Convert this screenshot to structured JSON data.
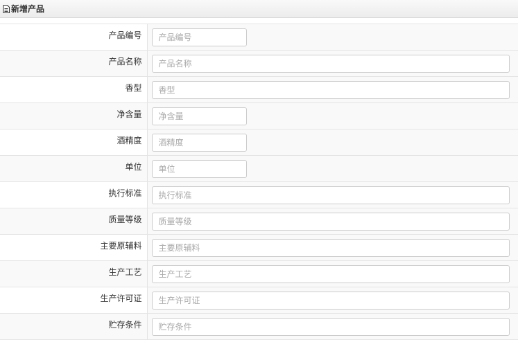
{
  "header": {
    "title": "新增产品",
    "icon": "document-icon"
  },
  "form": {
    "fields": [
      {
        "label": "产品编号",
        "placeholder": "产品编号",
        "width": "short"
      },
      {
        "label": "产品名称",
        "placeholder": "产品名称",
        "width": "long"
      },
      {
        "label": "香型",
        "placeholder": "香型",
        "width": "long"
      },
      {
        "label": "净含量",
        "placeholder": "净含量",
        "width": "short"
      },
      {
        "label": "酒精度",
        "placeholder": "酒精度",
        "width": "short"
      },
      {
        "label": "单位",
        "placeholder": "单位",
        "width": "short"
      },
      {
        "label": "执行标准",
        "placeholder": "执行标准",
        "width": "long"
      },
      {
        "label": "质量等级",
        "placeholder": "质量等级",
        "width": "long"
      },
      {
        "label": "主要原辅料",
        "placeholder": "主要原辅料",
        "width": "long"
      },
      {
        "label": "生产工艺",
        "placeholder": "生产工艺",
        "width": "long"
      },
      {
        "label": "生产许可证",
        "placeholder": "生产许可证",
        "width": "long"
      },
      {
        "label": "贮存条件",
        "placeholder": "贮存条件",
        "width": "long"
      }
    ]
  }
}
